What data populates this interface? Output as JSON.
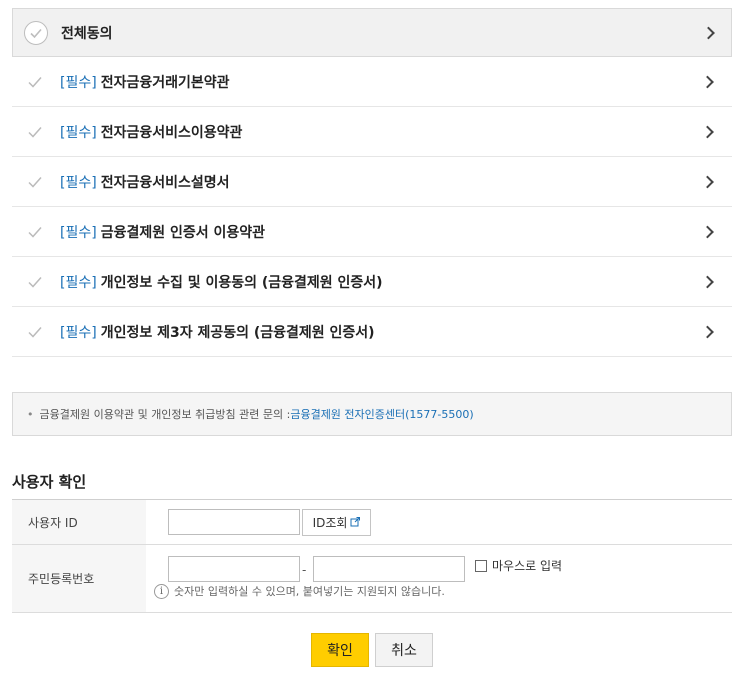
{
  "agree_all": {
    "label": "전체동의"
  },
  "terms": [
    {
      "tag": "[필수]",
      "label": "전자금융거래기본약관"
    },
    {
      "tag": "[필수]",
      "label": "전자금융서비스이용약관"
    },
    {
      "tag": "[필수]",
      "label": "전자금융서비스설명서"
    },
    {
      "tag": "[필수]",
      "label": "금융결제원 인증서 이용약관"
    },
    {
      "tag": "[필수]",
      "label": "개인정보 수집 및 이용동의 (금융결제원 인증서)"
    },
    {
      "tag": "[필수]",
      "label": "개인정보 제3자 제공동의 (금융결제원 인증서)"
    }
  ],
  "notice": {
    "bullet": "•",
    "text": "금융결제원 이용약관 및 개인정보 취급방침 관련 문의 : ",
    "link": "금융결제원 전자인증센터(1577-5500)"
  },
  "user_check": {
    "title": "사용자 확인",
    "user_id_label": "사용자 ID",
    "user_id_value": "",
    "id_lookup_button": "ID조회",
    "rrn_label": "주민등록번호",
    "rrn_front_value": "",
    "rrn_back_value": "",
    "rrn_separator": "-",
    "mouse_input_label": "마우스로 입력",
    "hint_icon": "i",
    "hint": "숫자만 입력하실 수 있으며, 붙여넣기는 지원되지 않습니다."
  },
  "buttons": {
    "confirm": "확인",
    "cancel": "취소"
  },
  "colors": {
    "accent_yellow": "#ffcd00",
    "link_blue": "#1a6fb5"
  }
}
